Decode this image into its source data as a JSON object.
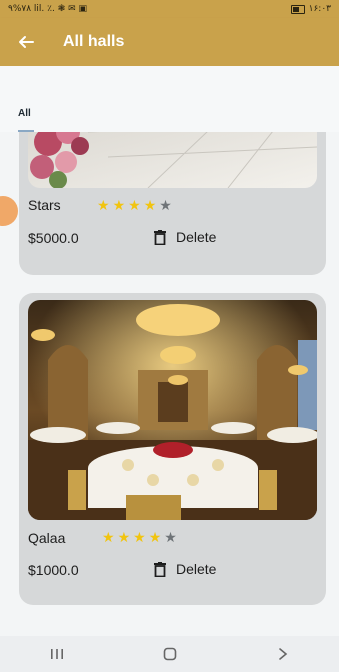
{
  "status_bar": {
    "left": "۹%۷۸ lil. ٪. ❃ ✉ ▣",
    "right": "۱۶:۰۳"
  },
  "app_bar": {
    "title": "All halls",
    "back_icon": "arrow-left-icon"
  },
  "tabs": [
    {
      "label": "All",
      "selected": true
    }
  ],
  "halls": [
    {
      "name": "Stars",
      "rating": 4,
      "max_rating": 5,
      "price": "$5000.0",
      "delete_label": "Delete"
    },
    {
      "name": "Qalaa",
      "rating": 4,
      "max_rating": 5,
      "price": "$1000.0",
      "delete_label": "Delete"
    }
  ],
  "nav_bar": {
    "recents_icon": "recents-icon",
    "home_icon": "home-icon",
    "back_icon": "chevron-right-icon"
  },
  "colors": {
    "primary": "#c9a24b",
    "star_on": "#f1c40f",
    "star_off": "#6f7478",
    "card_bg": "#d6d8d9"
  }
}
